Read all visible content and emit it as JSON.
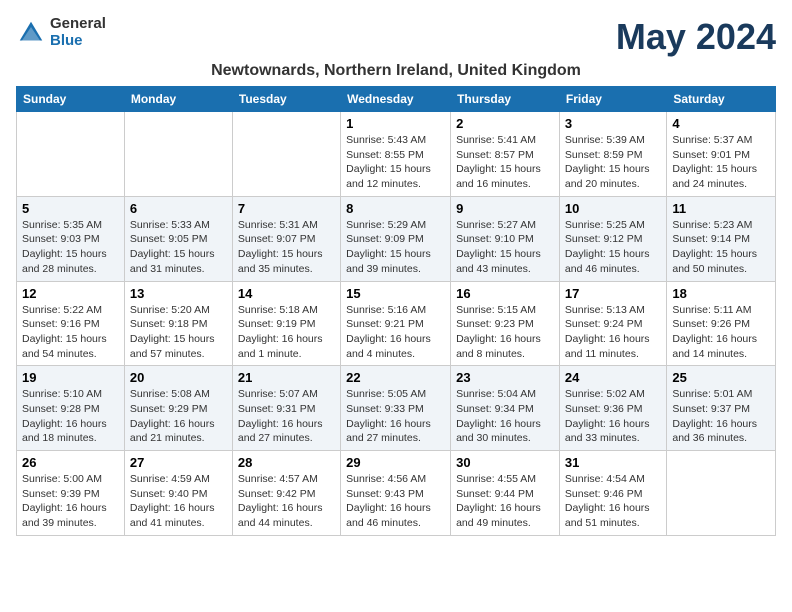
{
  "header": {
    "logo_general": "General",
    "logo_blue": "Blue",
    "month_title": "May 2024",
    "location": "Newtownards, Northern Ireland, United Kingdom"
  },
  "days_of_week": [
    "Sunday",
    "Monday",
    "Tuesday",
    "Wednesday",
    "Thursday",
    "Friday",
    "Saturday"
  ],
  "weeks": [
    [
      {
        "day": "",
        "info": ""
      },
      {
        "day": "",
        "info": ""
      },
      {
        "day": "",
        "info": ""
      },
      {
        "day": "1",
        "info": "Sunrise: 5:43 AM\nSunset: 8:55 PM\nDaylight: 15 hours\nand 12 minutes."
      },
      {
        "day": "2",
        "info": "Sunrise: 5:41 AM\nSunset: 8:57 PM\nDaylight: 15 hours\nand 16 minutes."
      },
      {
        "day": "3",
        "info": "Sunrise: 5:39 AM\nSunset: 8:59 PM\nDaylight: 15 hours\nand 20 minutes."
      },
      {
        "day": "4",
        "info": "Sunrise: 5:37 AM\nSunset: 9:01 PM\nDaylight: 15 hours\nand 24 minutes."
      }
    ],
    [
      {
        "day": "5",
        "info": "Sunrise: 5:35 AM\nSunset: 9:03 PM\nDaylight: 15 hours\nand 28 minutes."
      },
      {
        "day": "6",
        "info": "Sunrise: 5:33 AM\nSunset: 9:05 PM\nDaylight: 15 hours\nand 31 minutes."
      },
      {
        "day": "7",
        "info": "Sunrise: 5:31 AM\nSunset: 9:07 PM\nDaylight: 15 hours\nand 35 minutes."
      },
      {
        "day": "8",
        "info": "Sunrise: 5:29 AM\nSunset: 9:09 PM\nDaylight: 15 hours\nand 39 minutes."
      },
      {
        "day": "9",
        "info": "Sunrise: 5:27 AM\nSunset: 9:10 PM\nDaylight: 15 hours\nand 43 minutes."
      },
      {
        "day": "10",
        "info": "Sunrise: 5:25 AM\nSunset: 9:12 PM\nDaylight: 15 hours\nand 46 minutes."
      },
      {
        "day": "11",
        "info": "Sunrise: 5:23 AM\nSunset: 9:14 PM\nDaylight: 15 hours\nand 50 minutes."
      }
    ],
    [
      {
        "day": "12",
        "info": "Sunrise: 5:22 AM\nSunset: 9:16 PM\nDaylight: 15 hours\nand 54 minutes."
      },
      {
        "day": "13",
        "info": "Sunrise: 5:20 AM\nSunset: 9:18 PM\nDaylight: 15 hours\nand 57 minutes."
      },
      {
        "day": "14",
        "info": "Sunrise: 5:18 AM\nSunset: 9:19 PM\nDaylight: 16 hours\nand 1 minute."
      },
      {
        "day": "15",
        "info": "Sunrise: 5:16 AM\nSunset: 9:21 PM\nDaylight: 16 hours\nand 4 minutes."
      },
      {
        "day": "16",
        "info": "Sunrise: 5:15 AM\nSunset: 9:23 PM\nDaylight: 16 hours\nand 8 minutes."
      },
      {
        "day": "17",
        "info": "Sunrise: 5:13 AM\nSunset: 9:24 PM\nDaylight: 16 hours\nand 11 minutes."
      },
      {
        "day": "18",
        "info": "Sunrise: 5:11 AM\nSunset: 9:26 PM\nDaylight: 16 hours\nand 14 minutes."
      }
    ],
    [
      {
        "day": "19",
        "info": "Sunrise: 5:10 AM\nSunset: 9:28 PM\nDaylight: 16 hours\nand 18 minutes."
      },
      {
        "day": "20",
        "info": "Sunrise: 5:08 AM\nSunset: 9:29 PM\nDaylight: 16 hours\nand 21 minutes."
      },
      {
        "day": "21",
        "info": "Sunrise: 5:07 AM\nSunset: 9:31 PM\nDaylight: 16 hours\nand 27 minutes."
      },
      {
        "day": "22",
        "info": "Sunrise: 5:05 AM\nSunset: 9:33 PM\nDaylight: 16 hours\nand 27 minutes."
      },
      {
        "day": "23",
        "info": "Sunrise: 5:04 AM\nSunset: 9:34 PM\nDaylight: 16 hours\nand 30 minutes."
      },
      {
        "day": "24",
        "info": "Sunrise: 5:02 AM\nSunset: 9:36 PM\nDaylight: 16 hours\nand 33 minutes."
      },
      {
        "day": "25",
        "info": "Sunrise: 5:01 AM\nSunset: 9:37 PM\nDaylight: 16 hours\nand 36 minutes."
      }
    ],
    [
      {
        "day": "26",
        "info": "Sunrise: 5:00 AM\nSunset: 9:39 PM\nDaylight: 16 hours\nand 39 minutes."
      },
      {
        "day": "27",
        "info": "Sunrise: 4:59 AM\nSunset: 9:40 PM\nDaylight: 16 hours\nand 41 minutes."
      },
      {
        "day": "28",
        "info": "Sunrise: 4:57 AM\nSunset: 9:42 PM\nDaylight: 16 hours\nand 44 minutes."
      },
      {
        "day": "29",
        "info": "Sunrise: 4:56 AM\nSunset: 9:43 PM\nDaylight: 16 hours\nand 46 minutes."
      },
      {
        "day": "30",
        "info": "Sunrise: 4:55 AM\nSunset: 9:44 PM\nDaylight: 16 hours\nand 49 minutes."
      },
      {
        "day": "31",
        "info": "Sunrise: 4:54 AM\nSunset: 9:46 PM\nDaylight: 16 hours\nand 51 minutes."
      },
      {
        "day": "",
        "info": ""
      }
    ]
  ]
}
